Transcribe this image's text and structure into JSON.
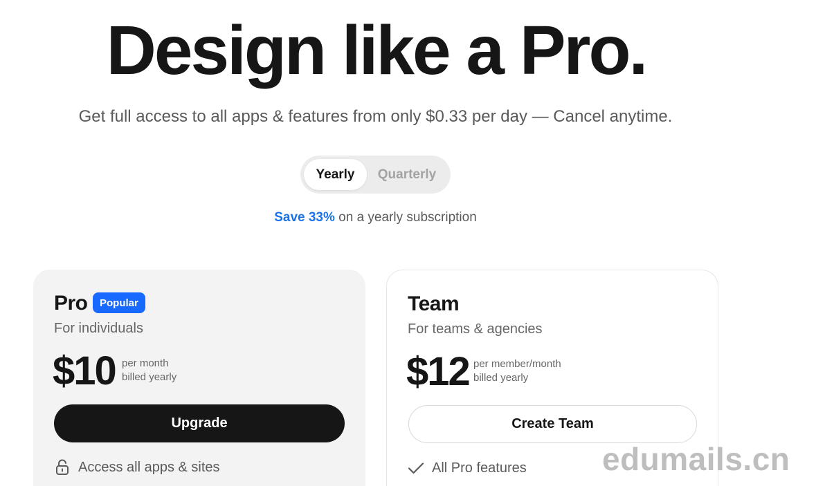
{
  "hero": {
    "title": "Design like a Pro.",
    "subtitle": "Get full access to all apps & features from only $0.33 per day — Cancel anytime."
  },
  "billing_toggle": {
    "options": [
      {
        "label": "Yearly",
        "active": true
      },
      {
        "label": "Quarterly",
        "active": false
      }
    ]
  },
  "savings": {
    "highlight": "Save 33%",
    "text": " on a yearly subscription"
  },
  "plans": [
    {
      "name": "Pro",
      "badge": "Popular",
      "description": "For individuals",
      "price": "$10",
      "price_note_1": "per month",
      "price_note_2": "billed yearly",
      "button_label": "Upgrade",
      "feature": {
        "icon": "unlock-icon",
        "text": "Access all apps & sites"
      }
    },
    {
      "name": "Team",
      "description": "For teams & agencies",
      "price": "$12",
      "price_note_1": "per member/month",
      "price_note_2": "billed yearly",
      "button_label": "Create Team",
      "feature": {
        "icon": "check-icon",
        "text": "All Pro features"
      }
    }
  ],
  "watermark": "edumails.cn",
  "colors": {
    "accent_blue": "#1a73e8",
    "badge_blue": "#1769ff",
    "dark_button": "#161616",
    "pro_card_bg": "#f3f3f3"
  }
}
